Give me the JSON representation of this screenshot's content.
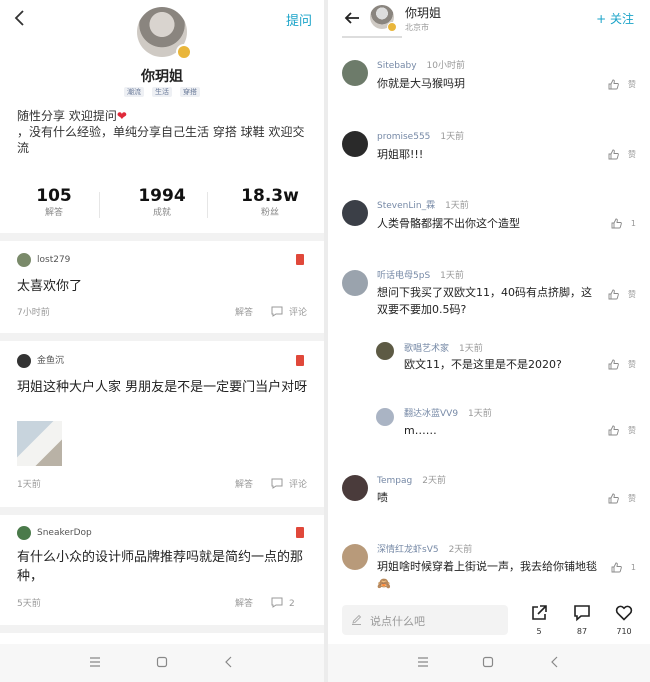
{
  "left": {
    "ask_label": "提问",
    "name": "你玥姐",
    "tags": [
      "潮流",
      "生活",
      "穿搭"
    ],
    "bio_line1": "随性分享 欢迎提问",
    "bio_line2": "，没有什么经验，单纯分享自己生活 穿搭  球鞋  欢迎交流",
    "stats": [
      {
        "value": "105",
        "label": "解答"
      },
      {
        "value": "1994",
        "label": "成就"
      },
      {
        "value": "18.3w",
        "label": "粉丝"
      }
    ],
    "cards": [
      {
        "user": "lost279",
        "text": "太喜欢你了",
        "time": "7小时前",
        "answer": "解答",
        "comment": "评论"
      },
      {
        "user": "金鱼沉",
        "text": "玥姐这种大户人家 男朋友是不是一定要门当户对呀",
        "time": "1天前",
        "answer": "解答",
        "comment": "评论"
      },
      {
        "user": "SneakerDop",
        "text": "有什么小众的设计师品牌推荐吗就是简约一点的那种，",
        "time": "5天前",
        "answer": "解答",
        "comment": "2"
      }
    ]
  },
  "right": {
    "name": "你玥姐",
    "location": "北京市",
    "follow_label": "+ 关注",
    "comments": [
      {
        "user": "Sitebaby",
        "time": "10小时前",
        "text": "你就是大马猴吗玥",
        "likes": "赞"
      },
      {
        "user": "promise555",
        "time": "1天前",
        "text": "玥姐耶!!!",
        "likes": "赞"
      },
      {
        "user": "StevenLin_霖",
        "time": "1天前",
        "text": "人类骨骼都摆不出你这个造型",
        "likes": "1"
      },
      {
        "user": "听话电母5pS",
        "time": "1天前",
        "text": "想问下我买了双欧文11，40码有点挤脚，这双要不要加0.5码?",
        "likes": "赞"
      },
      {
        "user": "歌唱艺术家",
        "time": "1天前",
        "text": "欧文11，不是这里是不是2020?",
        "likes": "赞"
      },
      {
        "user": "翻达冰蓝VV9",
        "time": "1天前",
        "text": "m……",
        "likes": "赞"
      },
      {
        "user": "Tempag",
        "time": "2天前",
        "text": "啧",
        "likes": "赞"
      },
      {
        "user": "深情红龙虾sV5",
        "time": "2天前",
        "text": "玥姐啥时候穿着上街说一声，我去给你铺地毯🙈",
        "likes": "1"
      }
    ],
    "input_placeholder": "说点什么吧",
    "actions": [
      {
        "icon": "share-icon",
        "count": "5"
      },
      {
        "icon": "comment-icon",
        "count": "87"
      },
      {
        "icon": "heart-icon",
        "count": "710"
      }
    ]
  },
  "colors": {
    "accent": "#1aa3c8",
    "username": "#7689a6",
    "heart": "#e02a3a"
  }
}
